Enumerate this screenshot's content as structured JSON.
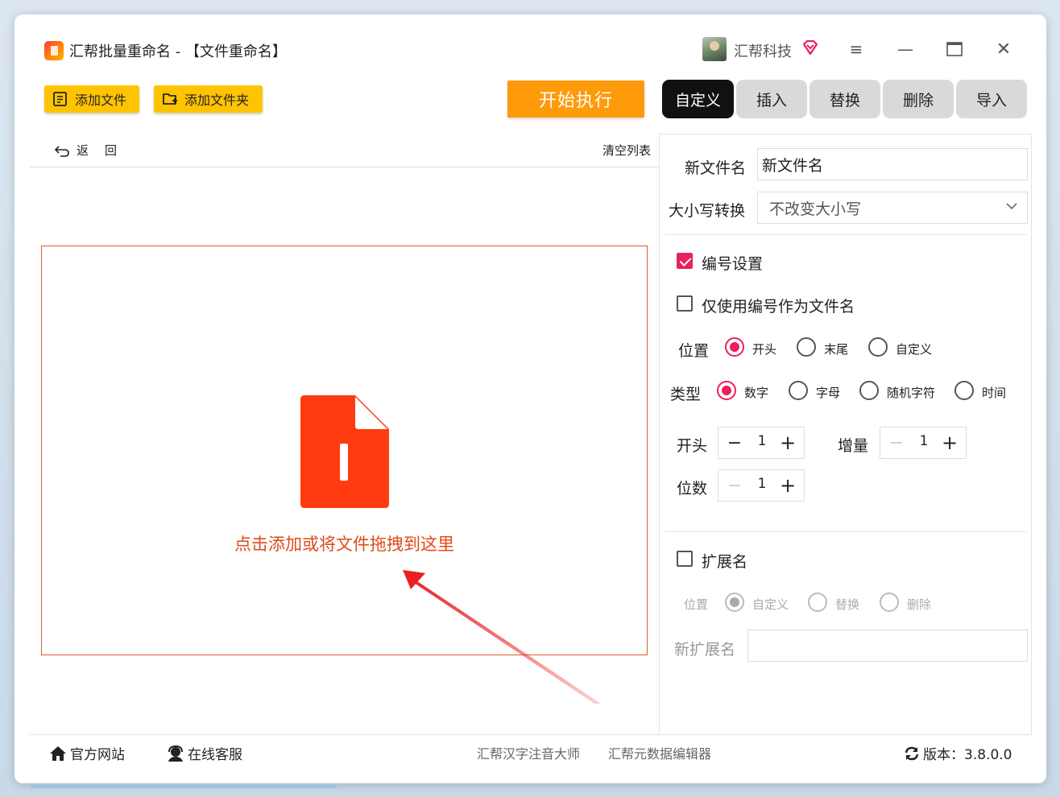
{
  "app": {
    "title": "汇帮批量重命名 - 【文件重命名】",
    "user_name": "汇帮科技"
  },
  "window_controls": {
    "menu": "≡",
    "minimize": "—",
    "maximize": "☐",
    "close": "✕"
  },
  "toolbar": {
    "add_file": "添加文件",
    "add_folder": "添加文件夹",
    "start": "开始执行"
  },
  "tabs": [
    {
      "label": "自定义",
      "active": true
    },
    {
      "label": "插入",
      "active": false
    },
    {
      "label": "替换",
      "active": false
    },
    {
      "label": "删除",
      "active": false
    },
    {
      "label": "导入",
      "active": false
    }
  ],
  "file_list": {
    "back_a": "返",
    "back_b": "回",
    "clear": "清空列表",
    "drop_hint": "点击添加或将文件拖拽到这里"
  },
  "settings": {
    "new_name_label": "新文件名",
    "new_name_value": "新文件名",
    "case_label": "大小写转换",
    "case_value": "不改变大小写",
    "numbering": {
      "label": "编号设置",
      "checked": true,
      "only_number_label": "仅使用编号作为文件名",
      "only_number_checked": false,
      "position_label": "位置",
      "position_options": [
        "开头",
        "末尾",
        "自定义"
      ],
      "position_selected": "开头",
      "type_label": "类型",
      "type_options": [
        "数字",
        "字母",
        "随机字符",
        "时间"
      ],
      "type_selected": "数字",
      "start_label": "开头",
      "start_value": "1",
      "increment_label": "增量",
      "increment_value": "1",
      "digits_label": "位数",
      "digits_value": "1",
      "minus": "−",
      "plus": "+"
    },
    "extension": {
      "label": "扩展名",
      "checked": false,
      "position_label": "位置",
      "options": [
        "自定义",
        "替换",
        "删除"
      ],
      "selected": "自定义",
      "new_ext_label": "新扩展名",
      "new_ext_value": ""
    }
  },
  "footer": {
    "website": "官方网站",
    "support": "在线客服",
    "link1": "汇帮汉字注音大师",
    "link2": "汇帮元数据编辑器",
    "version": "版本：3.8.0.0"
  },
  "colors": {
    "accent_yellow": "#ffc400",
    "start_orange": "#ff9a0a",
    "brand_red": "#ff3b0f",
    "check_pink": "#e8215a",
    "drop_border": "#e05a2b"
  }
}
